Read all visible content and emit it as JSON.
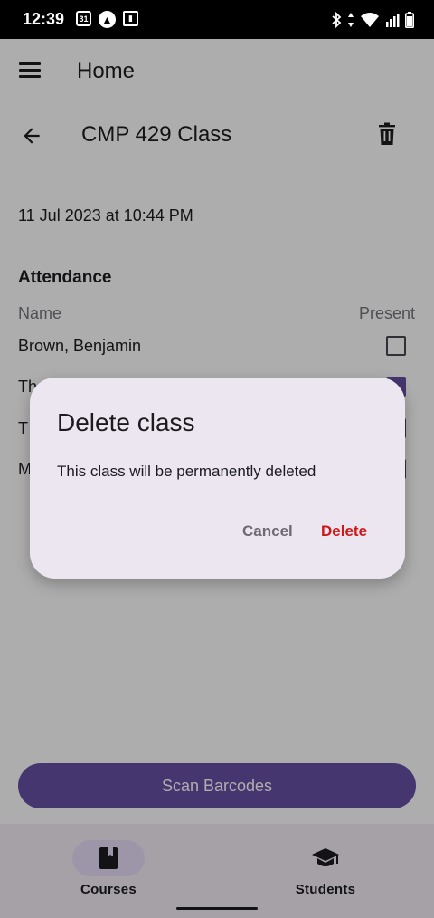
{
  "status_bar": {
    "time": "12:39",
    "calendar_day": "31",
    "left_icons": [
      "calendar-icon",
      "app-a-icon",
      "media-icon"
    ],
    "right_icons": [
      "bluetooth-icon",
      "data-arrows-icon",
      "wifi-icon",
      "signal-icon",
      "battery-icon"
    ]
  },
  "app_bar": {
    "title": "Home",
    "menu_icon": "menu-icon"
  },
  "class_bar": {
    "title": "CMP 429 Class",
    "back_icon": "arrow-back-icon",
    "delete_icon": "trash-icon"
  },
  "content": {
    "date": "11 Jul 2023 at 10:44 PM",
    "attendance_heading": "Attendance",
    "col_name": "Name",
    "col_present": "Present",
    "rows": [
      {
        "name": "Brown, Benjamin",
        "present": false
      },
      {
        "name": "Th",
        "present": true
      },
      {
        "name": "T",
        "present": false
      },
      {
        "name": "M",
        "present": false
      }
    ]
  },
  "scan_button": "Scan Barcodes",
  "bottom_nav": {
    "items": [
      {
        "label": "Courses",
        "icon": "book-icon",
        "active": true
      },
      {
        "label": "Students",
        "icon": "graduation-cap-icon",
        "active": false
      }
    ]
  },
  "dialog": {
    "title": "Delete class",
    "body": "This class will be permanently deleted",
    "cancel": "Cancel",
    "confirm": "Delete"
  },
  "colors": {
    "primary": "#6750a4",
    "danger": "#d01818",
    "dialog_surface": "#ece6f0",
    "nav_surface": "#f3edf7"
  }
}
